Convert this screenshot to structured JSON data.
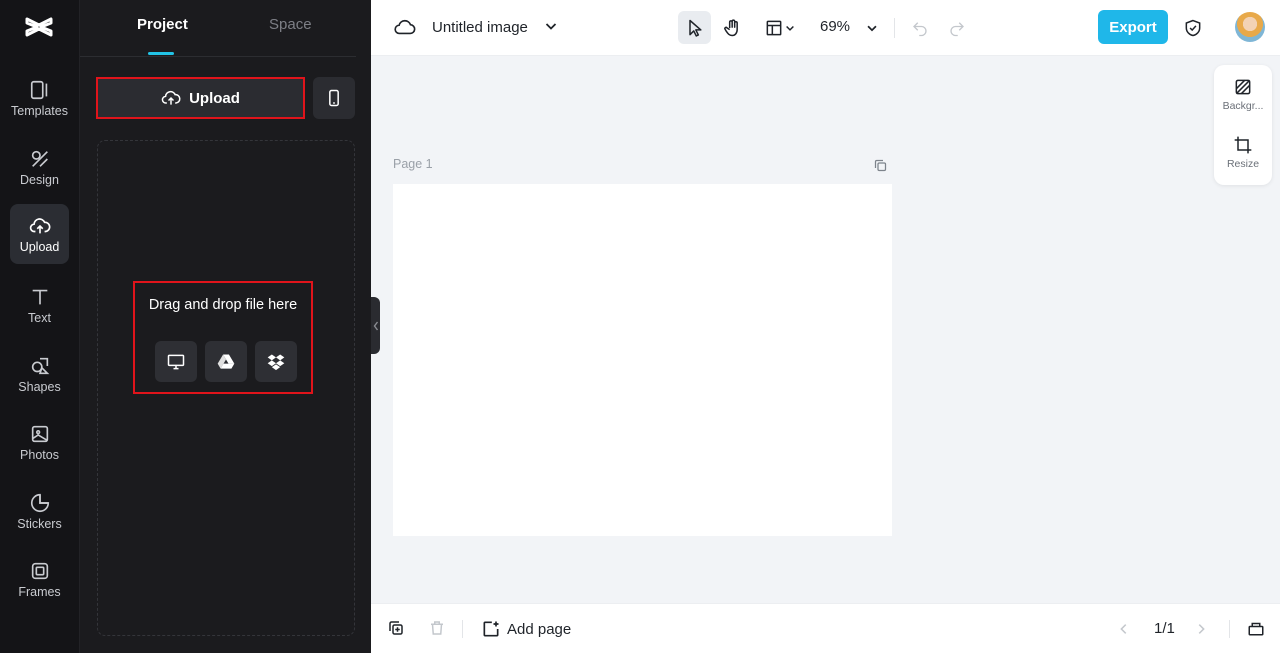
{
  "rail": {
    "items": [
      {
        "label": "Templates",
        "icon": "templates-icon"
      },
      {
        "label": "Design",
        "icon": "design-icon"
      },
      {
        "label": "Upload",
        "icon": "upload-cloud-icon",
        "active": true
      },
      {
        "label": "Text",
        "icon": "text-icon"
      },
      {
        "label": "Shapes",
        "icon": "shapes-icon"
      },
      {
        "label": "Photos",
        "icon": "photos-icon"
      },
      {
        "label": "Stickers",
        "icon": "stickers-icon"
      },
      {
        "label": "Frames",
        "icon": "frames-icon"
      }
    ]
  },
  "panel": {
    "tabs": [
      "Project",
      "Space"
    ],
    "upload_label": "Upload",
    "drop_text": "Drag and drop file here",
    "sources": [
      "computer-icon",
      "google-drive-icon",
      "dropbox-icon"
    ]
  },
  "topbar": {
    "title": "Untitled image",
    "zoom": "69%",
    "export_label": "Export"
  },
  "canvas": {
    "page_label": "Page 1"
  },
  "side_tools": {
    "background_label": "Backgr...",
    "resize_label": "Resize"
  },
  "bottombar": {
    "add_page_label": "Add page",
    "pager": "1/1"
  },
  "colors": {
    "accent": "#1fb7e9",
    "highlight_border": "#e0141b",
    "rail_bg": "#141417",
    "panel_bg": "#1b1b1e",
    "canvas_bg": "#f2f4f7"
  }
}
